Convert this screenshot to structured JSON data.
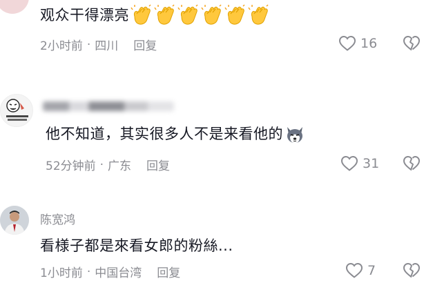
{
  "comments": [
    {
      "username": "",
      "text": "观众干得漂亮",
      "emoji": "clapping-hands-emoji",
      "emoji_count": 6,
      "time": "2小时前",
      "location": "四川",
      "reply_label": "回复",
      "likes": "16"
    },
    {
      "username": "",
      "text": "他不知道，其实很多人不是来看他的",
      "emoji": "wolf-dog-emoji",
      "time": "52分钟前",
      "location": "广东",
      "reply_label": "回复",
      "likes": "31"
    },
    {
      "username": "陈宽鸿",
      "text": "看様子都是來看女郎的粉絲...",
      "time": "1小时前",
      "location": "中国台湾",
      "reply_label": "回复",
      "likes": "7"
    }
  ],
  "separator": "·",
  "colors": {
    "primary_text": "#161823",
    "secondary_text": "#8a8b91",
    "icon": "#8a8b91"
  }
}
